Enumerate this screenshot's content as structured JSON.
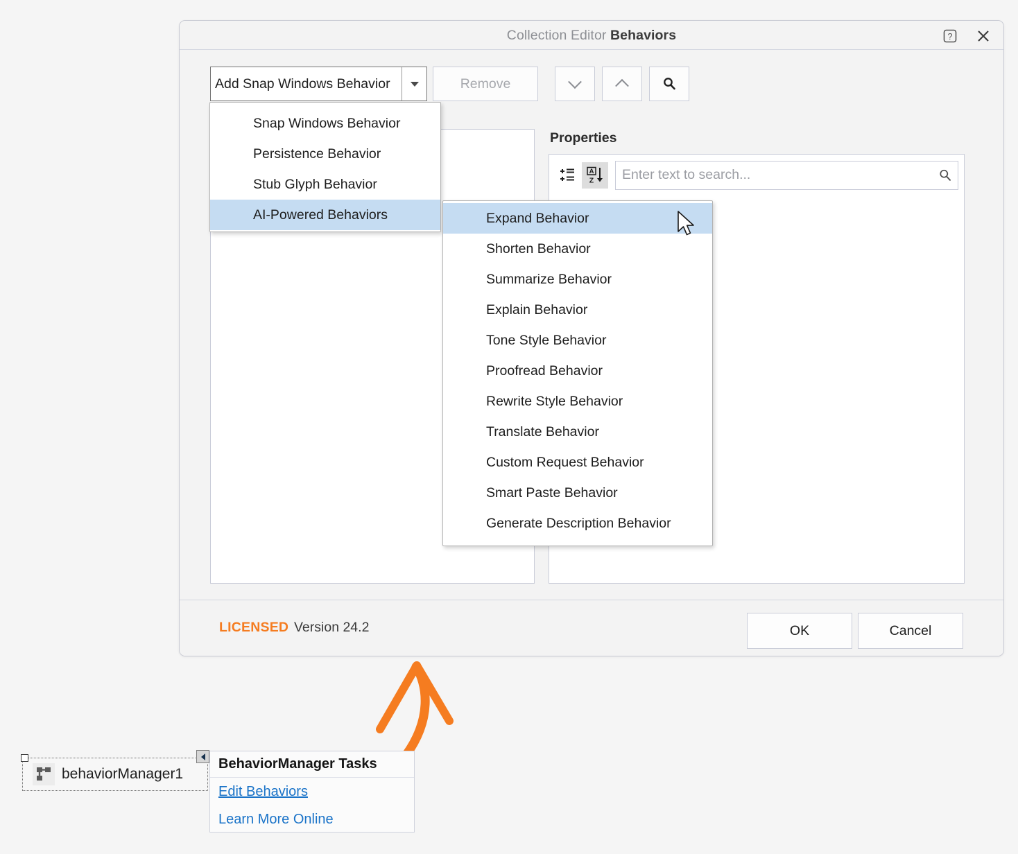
{
  "dialog": {
    "title_prefix": "Collection Editor ",
    "title_main": "Behaviors",
    "help_icon": "help-icon",
    "close_icon": "close-icon"
  },
  "toolbar": {
    "combo_value": "Add Snap Windows Behavior",
    "combo_arrow_icon": "chevron-down-icon",
    "remove_label": "Remove",
    "move_down_icon": "chevron-down-icon",
    "move_up_icon": "chevron-up-icon",
    "search_icon": "search-icon"
  },
  "properties": {
    "heading": "Properties",
    "categorized_icon": "categorized-list-icon",
    "alphabetical_icon": "alphabetical-sort-icon",
    "search_placeholder": "Enter text to search...",
    "search_value": "",
    "search_icon": "search-icon"
  },
  "menu": {
    "items": [
      {
        "label": "Snap Windows Behavior",
        "selected": false,
        "has_submenu": false
      },
      {
        "label": "Persistence Behavior",
        "selected": false,
        "has_submenu": false
      },
      {
        "label": "Stub Glyph Behavior",
        "selected": false,
        "has_submenu": false
      },
      {
        "label": "AI-Powered Behaviors",
        "selected": true,
        "has_submenu": true
      }
    ]
  },
  "submenu": {
    "items": [
      {
        "label": "Expand Behavior",
        "selected": true
      },
      {
        "label": "Shorten Behavior",
        "selected": false
      },
      {
        "label": "Summarize Behavior",
        "selected": false
      },
      {
        "label": "Explain Behavior",
        "selected": false
      },
      {
        "label": "Tone Style Behavior",
        "selected": false
      },
      {
        "label": "Proofread Behavior",
        "selected": false
      },
      {
        "label": "Rewrite Style Behavior",
        "selected": false
      },
      {
        "label": "Translate Behavior",
        "selected": false
      },
      {
        "label": "Custom Request Behavior",
        "selected": false
      },
      {
        "label": "Smart Paste Behavior",
        "selected": false
      },
      {
        "label": "Generate Description Behavior",
        "selected": false
      }
    ]
  },
  "footer": {
    "licensed": "LICENSED",
    "version": "Version 24.2",
    "ok_label": "OK",
    "cancel_label": "Cancel"
  },
  "designer": {
    "component_name": "behaviorManager1",
    "component_icon": "behavior-manager-icon",
    "smarttag_icon": "smart-tag-arrow-icon",
    "tasks_title": "BehaviorManager Tasks",
    "task_links": [
      "Edit Behaviors",
      "Learn More Online"
    ]
  },
  "annotation": {
    "arrow_color": "#f57c20",
    "arrow_icon": "curved-arrow-annotation"
  },
  "cursor": {
    "icon": "mouse-pointer-icon"
  },
  "colors": {
    "accent_orange": "#f57c20",
    "menu_highlight": "#c5dcf2",
    "link_blue": "#1a73c8",
    "page_bg": "#f5f5f5",
    "dialog_bg": "#f3f3f3"
  }
}
